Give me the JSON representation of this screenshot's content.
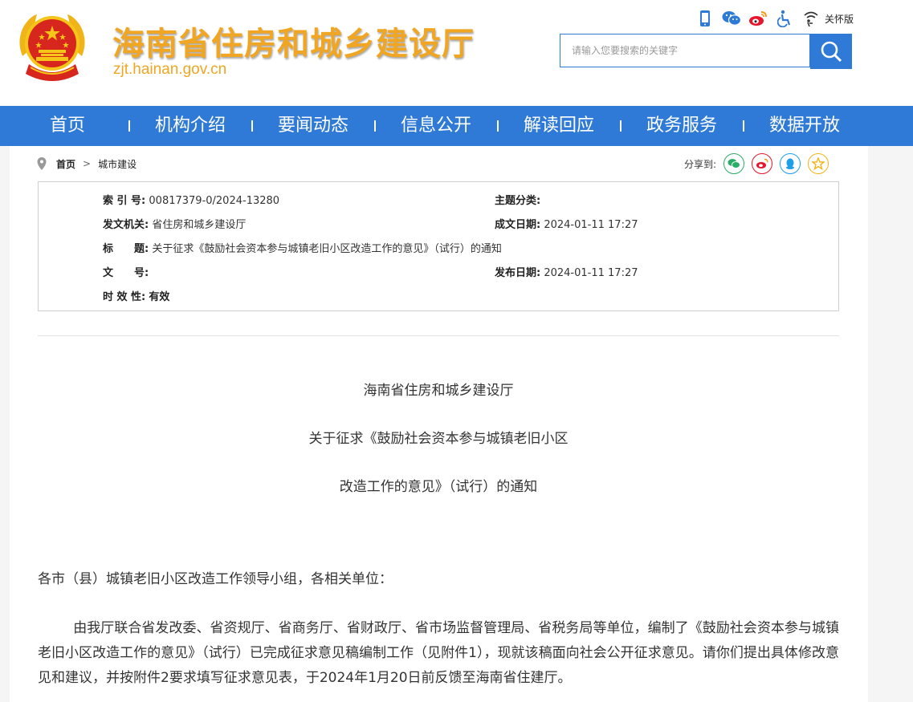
{
  "site": {
    "title": "海南省住房和城乡建设厅",
    "domain": "zjt.hainan.gov.cn",
    "care_mode": "关怀版"
  },
  "top_icons": [
    "phone-icon",
    "wechat-icon",
    "weibo-icon",
    "accessibility-icon",
    "elder-care-icon"
  ],
  "search": {
    "placeholder": "请输入您要搜索的关键字"
  },
  "nav": [
    "首页",
    "机构介绍",
    "要闻动态",
    "信息公开",
    "解读回应",
    "政务服务",
    "数据开放"
  ],
  "breadcrumb": {
    "home": "首页",
    "arrow": ">",
    "current": "城市建设"
  },
  "share": {
    "label": "分享到:",
    "icons": [
      "wechat-icon",
      "weibo-icon",
      "qq-icon",
      "favorite-icon"
    ]
  },
  "meta": {
    "index_label": "索 引 号:",
    "index_value": "00817379-0/2024-13280",
    "category_label": "主题分类:",
    "category_value": "",
    "issuer_label": "发文机关:",
    "issuer_value": "省住房和城乡建设厅",
    "created_label": "成文日期:",
    "created_value": "2024-01-11 17:27",
    "title_label": "标　　题:",
    "title_value": "关于征求《鼓励社会资本参与城镇老旧小区改造工作的意见》（试行）的通知",
    "docno_label": "文　　号:",
    "docno_value": "",
    "published_label": "发布日期:",
    "published_value": "2024-01-11 17:27",
    "validity_label": "时 效 性:",
    "validity_value": "有效"
  },
  "doc": {
    "org": "海南省住房和城乡建设厅",
    "title_line1": "关于征求《鼓励社会资本参与城镇老旧小区",
    "title_line2": "改造工作的意见》（试行）的通知",
    "salutation": "各市（县）城镇老旧小区改造工作领导小组，各相关单位：",
    "body": "由我厅联合省发改委、省资规厅、省商务厅、省财政厅、省市场监督管理局、省税务局等单位，编制了《鼓励社会资本参与城镇老旧小区改造工作的意见》（试行）已完成征求意见稿编制工作（见附件1），现就该稿面向社会公开征求意见。请你们提出具体修改意见和建议，并按附件2要求填写征求意见表，于2024年1月20日前反馈至海南省住建厅。"
  },
  "colors": {
    "primary": "#2f7ad6",
    "title": "#f0a623",
    "emblem_red": "#d7261e",
    "emblem_gold": "#f5c518"
  }
}
